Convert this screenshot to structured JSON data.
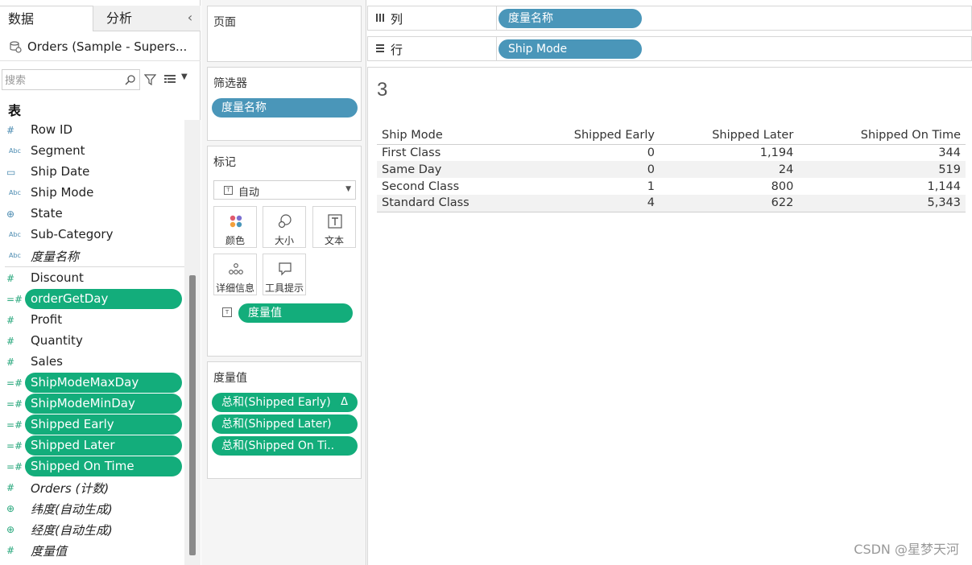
{
  "data_pane": {
    "tabs": [
      "数据",
      "分析"
    ],
    "collapse_glyph": "‹",
    "datasource": "Orders (Sample - Supers...",
    "search_placeholder": "搜索",
    "tables_heading": "表",
    "dimensions": [
      {
        "icon": "#",
        "icon_name": "number-icon",
        "label": "Row ID"
      },
      {
        "icon": "Abc",
        "icon_name": "text-icon",
        "label": "Segment"
      },
      {
        "icon": "▭",
        "icon_name": "calendar-icon",
        "label": "Ship Date"
      },
      {
        "icon": "Abc",
        "icon_name": "text-icon",
        "label": "Ship Mode"
      },
      {
        "icon": "⊕",
        "icon_name": "globe-icon",
        "label": "State"
      },
      {
        "icon": "Abc",
        "icon_name": "text-icon",
        "label": "Sub-Category"
      },
      {
        "icon": "Abc",
        "icon_name": "text-icon",
        "label": "度量名称"
      }
    ],
    "measures": [
      {
        "icon": "#",
        "icon_name": "number-icon",
        "label": "Discount"
      },
      {
        "icon": "=#",
        "icon_name": "calculated-number-icon",
        "label": "orderGetDay"
      },
      {
        "icon": "#",
        "icon_name": "number-icon",
        "label": "Profit"
      },
      {
        "icon": "#",
        "icon_name": "number-icon",
        "label": "Quantity"
      },
      {
        "icon": "#",
        "icon_name": "number-icon",
        "label": "Sales"
      },
      {
        "icon": "=#",
        "icon_name": "calculated-number-icon",
        "label": "ShipModeMaxDay"
      },
      {
        "icon": "=#",
        "icon_name": "calculated-number-icon",
        "label": "ShipModeMinDay"
      },
      {
        "icon": "=#",
        "icon_name": "calculated-number-icon",
        "label": "Shipped Early"
      },
      {
        "icon": "=#",
        "icon_name": "calculated-number-icon",
        "label": "Shipped Later"
      },
      {
        "icon": "=#",
        "icon_name": "calculated-number-icon",
        "label": "Shipped On Time"
      },
      {
        "icon": "#",
        "icon_name": "number-icon",
        "label": "Orders (计数)"
      },
      {
        "icon": "⊕",
        "icon_name": "globe-icon",
        "label": "纬度(自动生成)"
      },
      {
        "icon": "⊕",
        "icon_name": "globe-icon",
        "label": "经度(自动生成)"
      },
      {
        "icon": "#",
        "icon_name": "number-icon",
        "label": "度量值"
      }
    ]
  },
  "shelves": {
    "pages_title": "页面",
    "filters_title": "筛选器",
    "filters_pill": "度量名称",
    "marks_title": "标记",
    "mark_type": "自动",
    "mark_buttons": [
      "颜色",
      "大小",
      "文本",
      "详细信息",
      "工具提示"
    ],
    "marks_pill": "度量值",
    "measure_values_title": "度量值",
    "measure_values_pills": [
      "总和(Shipped Early)",
      "总和(Shipped Later)",
      "总和(Shipped On Ti.."
    ],
    "delta_glyph": "Δ",
    "columns_label": "列",
    "columns_pill": "度量名称",
    "rows_label": "行",
    "rows_pill": "Ship Mode"
  },
  "colors": {
    "dimension_pill": "#4a96b9",
    "measure_pill": "#13ad7b"
  },
  "worksheet": {
    "title": "3",
    "headers": [
      "Ship Mode",
      "Shipped Early",
      "Shipped Later",
      "Shipped On Time"
    ],
    "rows": [
      [
        "First Class",
        "0",
        "1,194",
        "344"
      ],
      [
        "Same Day",
        "0",
        "24",
        "519"
      ],
      [
        "Second Class",
        "1",
        "800",
        "1,144"
      ],
      [
        "Standard Class",
        "4",
        "622",
        "5,343"
      ]
    ]
  },
  "watermark": "CSDN @星梦天河"
}
